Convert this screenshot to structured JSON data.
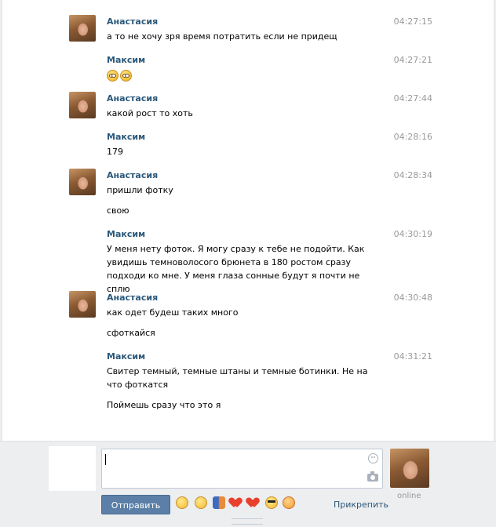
{
  "messages": [
    {
      "author": "Анастасия",
      "time": "04:27:15",
      "lines": [
        "а то не хочу зря время потратить если не придещ"
      ],
      "avatar": true
    },
    {
      "author": "Максим",
      "time": "04:27:21",
      "emoji": [
        "smile-eye-roll",
        "smile-eye-roll"
      ],
      "avatar": false
    },
    {
      "author": "Анастасия",
      "time": "04:27:44",
      "lines": [
        "какой рост то хоть"
      ],
      "avatar": true
    },
    {
      "author": "Максим",
      "time": "04:28:16",
      "lines": [
        "179"
      ],
      "avatar": false
    },
    {
      "author": "Анастасия",
      "time": "04:28:34",
      "lines": [
        "пришли фотку",
        "свою"
      ],
      "avatar": true
    },
    {
      "author": "Максим",
      "time": "04:30:19",
      "lines": [
        "У меня нету фоток. Я могу сразу к тебе не подойти. Как увидишь темноволосого брюнета в 180 ростом сразу подходи ко мне. У меня глаза сонные будут я почти не сплю"
      ],
      "avatar": false
    },
    {
      "author": "Анастасия",
      "time": "04:30:48",
      "lines": [
        "как одет будеш таких много",
        "сфоткайся"
      ],
      "avatar": true
    },
    {
      "author": "Максим",
      "time": "04:31:21",
      "lines": [
        "Свитер темный, темные штаны и темные ботинки. Не на что фоткатся",
        "Поймешь сразу что это я"
      ],
      "avatar": false
    }
  ],
  "composer": {
    "input_value": "",
    "send_label": "Отправить",
    "attach_label": "Прикрепить",
    "status": "online",
    "emoji_bar": [
      "rolling-eyes-emoji",
      "smile-emoji",
      "couple-emoji",
      "heart-emoji",
      "heart-emoji",
      "sunglasses-emoji",
      "tired-emoji"
    ]
  }
}
